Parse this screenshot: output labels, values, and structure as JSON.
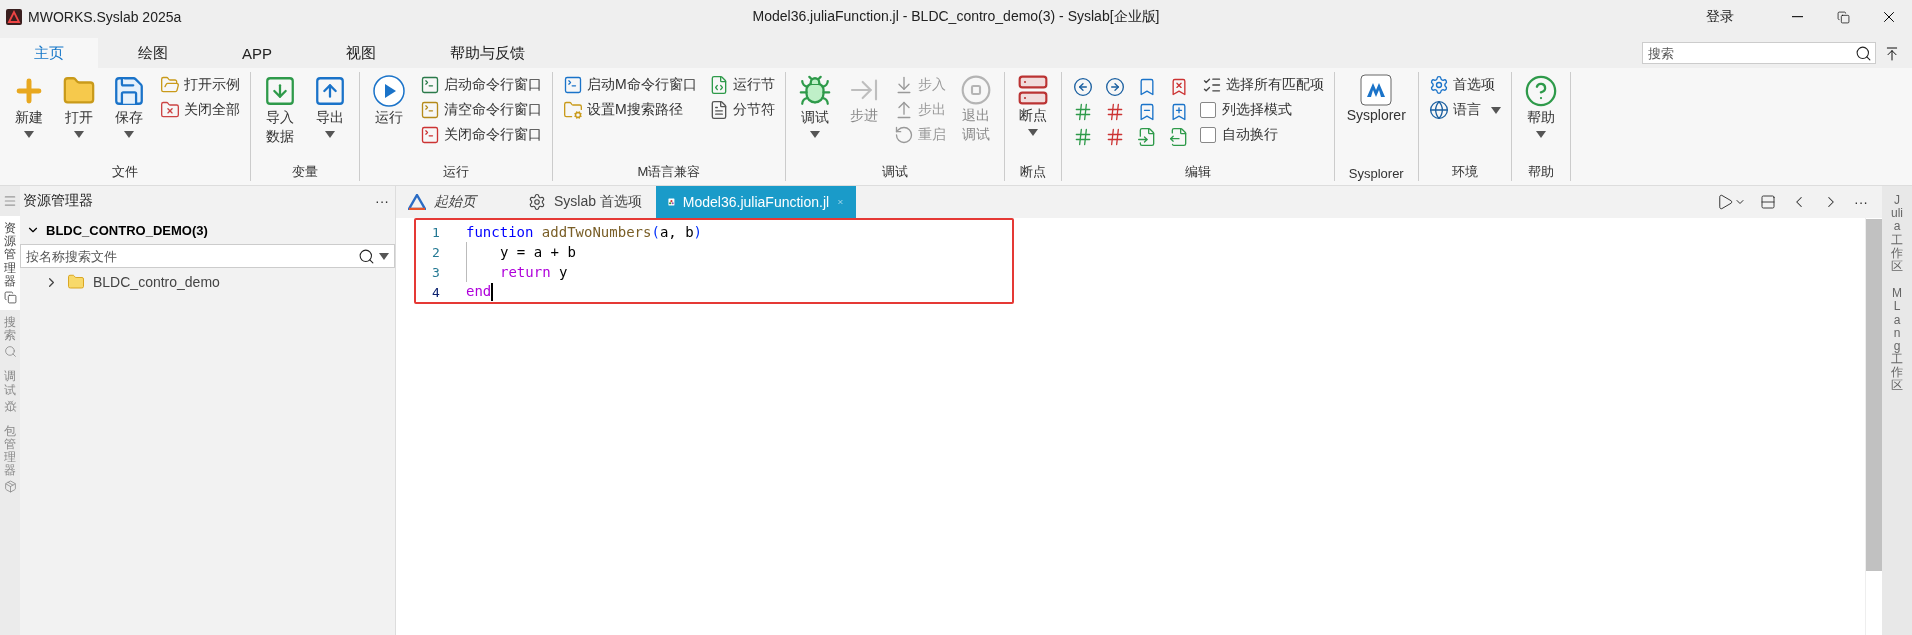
{
  "window": {
    "app_name": "MWORKS.Syslab 2025a",
    "title": "Model36.juliaFunction.jl - BLDC_contro_demo(3) - Syslab[企业版]",
    "login": "登录"
  },
  "ribbon_tabs": [
    {
      "label": "主页",
      "selected": true
    },
    {
      "label": "绘图",
      "selected": false
    },
    {
      "label": "APP",
      "selected": false
    },
    {
      "label": "视图",
      "selected": false
    },
    {
      "label": "帮助与反馈",
      "selected": false
    }
  ],
  "ribbon_search": {
    "placeholder": "搜索"
  },
  "ribbon_groups": [
    {
      "label": "文件",
      "items": [
        {
          "kind": "large",
          "lines": [
            "新建"
          ],
          "dropdown": true,
          "disabled": false
        },
        {
          "kind": "large",
          "lines": [
            "打开"
          ],
          "dropdown": true,
          "disabled": false
        },
        {
          "kind": "large",
          "lines": [
            "保存"
          ],
          "dropdown": true,
          "disabled": false
        },
        {
          "kind": "stack",
          "items": [
            {
              "kind": "button",
              "label": "打开示例",
              "dropdown": false,
              "disabled": false
            },
            {
              "kind": "button",
              "label": "关闭全部",
              "dropdown": false,
              "disabled": false
            }
          ]
        }
      ]
    },
    {
      "label": "变量",
      "items": [
        {
          "kind": "large",
          "lines": [
            "导入",
            "数据"
          ],
          "dropdown": false,
          "disabled": false
        },
        {
          "kind": "large",
          "lines": [
            "导出"
          ],
          "dropdown": true,
          "disabled": false
        }
      ]
    },
    {
      "label": "运行",
      "items": [
        {
          "kind": "large",
          "lines": [
            "运行"
          ],
          "dropdown": false,
          "disabled": false
        },
        {
          "kind": "stack",
          "items": [
            {
              "kind": "button",
              "label": "启动命令行窗口",
              "dropdown": false,
              "disabled": false
            },
            {
              "kind": "button",
              "label": "清空命令行窗口",
              "dropdown": false,
              "disabled": false
            },
            {
              "kind": "button",
              "label": "关闭命令行窗口",
              "dropdown": false,
              "disabled": false
            }
          ]
        }
      ]
    },
    {
      "label": "M语言兼容",
      "items": [
        {
          "kind": "stack",
          "items": [
            {
              "kind": "button",
              "label": "启动M命令行窗口",
              "dropdown": false,
              "disabled": false
            },
            {
              "kind": "button",
              "label": "设置M搜索路径",
              "dropdown": false,
              "disabled": false
            }
          ]
        },
        {
          "kind": "stack",
          "items": [
            {
              "kind": "button",
              "label": "运行节",
              "dropdown": false,
              "disabled": false
            },
            {
              "kind": "button",
              "label": "分节符",
              "dropdown": false,
              "disabled": false
            }
          ]
        }
      ]
    },
    {
      "label": "调试",
      "items": [
        {
          "kind": "large",
          "lines": [
            "调试"
          ],
          "dropdown": true,
          "disabled": false
        },
        {
          "kind": "large",
          "lines": [
            "步进"
          ],
          "dropdown": false,
          "disabled": true
        },
        {
          "kind": "stack",
          "items": [
            {
              "kind": "button",
              "label": "步入",
              "dropdown": false,
              "disabled": true
            },
            {
              "kind": "button",
              "label": "步出",
              "dropdown": false,
              "disabled": true
            },
            {
              "kind": "button",
              "label": "重启",
              "dropdown": false,
              "disabled": true
            }
          ]
        },
        {
          "kind": "large",
          "lines": [
            "退出",
            "调试"
          ],
          "dropdown": false,
          "disabled": true
        }
      ]
    },
    {
      "label": "断点",
      "items": [
        {
          "kind": "large",
          "lines": [
            "断点"
          ],
          "dropdown": true,
          "disabled": false
        }
      ]
    },
    {
      "label": "编辑",
      "items": [
        {
          "kind": "icon-grid"
        },
        {
          "kind": "stack",
          "items": [
            {
              "kind": "button",
              "label": "选择所有匹配项",
              "dropdown": false,
              "disabled": false
            },
            {
              "kind": "check",
              "label": "列选择模式",
              "checked": false,
              "disabled": false
            },
            {
              "kind": "check",
              "label": "自动换行",
              "checked": false,
              "disabled": false
            }
          ]
        }
      ]
    },
    {
      "label": "Sysplorer",
      "items": [
        {
          "kind": "large",
          "lines": [
            "Sysplorer"
          ],
          "dropdown": false,
          "disabled": false
        }
      ]
    },
    {
      "label": "环境",
      "items": [
        {
          "kind": "stack",
          "items": [
            {
              "kind": "button",
              "label": "首选项",
              "dropdown": false,
              "disabled": false
            },
            {
              "kind": "button",
              "label": "语言",
              "dropdown": true,
              "disabled": false
            }
          ]
        }
      ]
    },
    {
      "label": "帮助",
      "items": [
        {
          "kind": "large",
          "lines": [
            "帮助"
          ],
          "dropdown": true,
          "disabled": false
        }
      ]
    }
  ],
  "activity_bar": [
    {
      "label": "资源管理器",
      "selected": true
    },
    {
      "label": "搜索",
      "selected": false
    },
    {
      "label": "调试",
      "selected": false
    },
    {
      "label": "包管理器",
      "selected": false
    }
  ],
  "explorer": {
    "title": "资源管理器",
    "more": "···",
    "section": {
      "label": "BLDC_CONTRO_DEMO(3)",
      "expanded": true
    },
    "search": {
      "placeholder": "按名称搜索文件"
    },
    "tree": [
      {
        "label": "BLDC_contro_demo",
        "expanded": false
      }
    ]
  },
  "editor_tabs": [
    {
      "label": "起始页",
      "preview": true,
      "selected": false
    },
    {
      "label": "Syslab 首选项",
      "preview": false,
      "selected": false
    },
    {
      "label": "Model36.juliaFunction.jl",
      "preview": false,
      "selected": true
    }
  ],
  "editor_more": "···",
  "editor": {
    "highlight_box": true,
    "lines": [
      {
        "number": "1",
        "current": false,
        "indented": false,
        "tokens": [
          {
            "kind": "keyword",
            "text": "function"
          },
          {
            "kind": "function",
            "text": " addTwoNumbers"
          },
          {
            "kind": "bracket",
            "text": "("
          },
          {
            "kind": "plain",
            "text": "a, b"
          },
          {
            "kind": "bracket",
            "text": ")"
          }
        ]
      },
      {
        "number": "2",
        "current": false,
        "indented": true,
        "tokens": [
          {
            "kind": "plain",
            "text": "y = a + b"
          }
        ]
      },
      {
        "number": "3",
        "current": false,
        "indented": true,
        "tokens": [
          {
            "kind": "control",
            "text": "return"
          },
          {
            "kind": "plain",
            "text": " y"
          }
        ]
      },
      {
        "number": "4",
        "current": true,
        "indented": false,
        "tokens": [
          {
            "kind": "control",
            "text": "end"
          }
        ]
      }
    ]
  },
  "right_bar": [
    {
      "label": "Julia 工作区"
    },
    {
      "label": "MLang 工作区"
    }
  ]
}
